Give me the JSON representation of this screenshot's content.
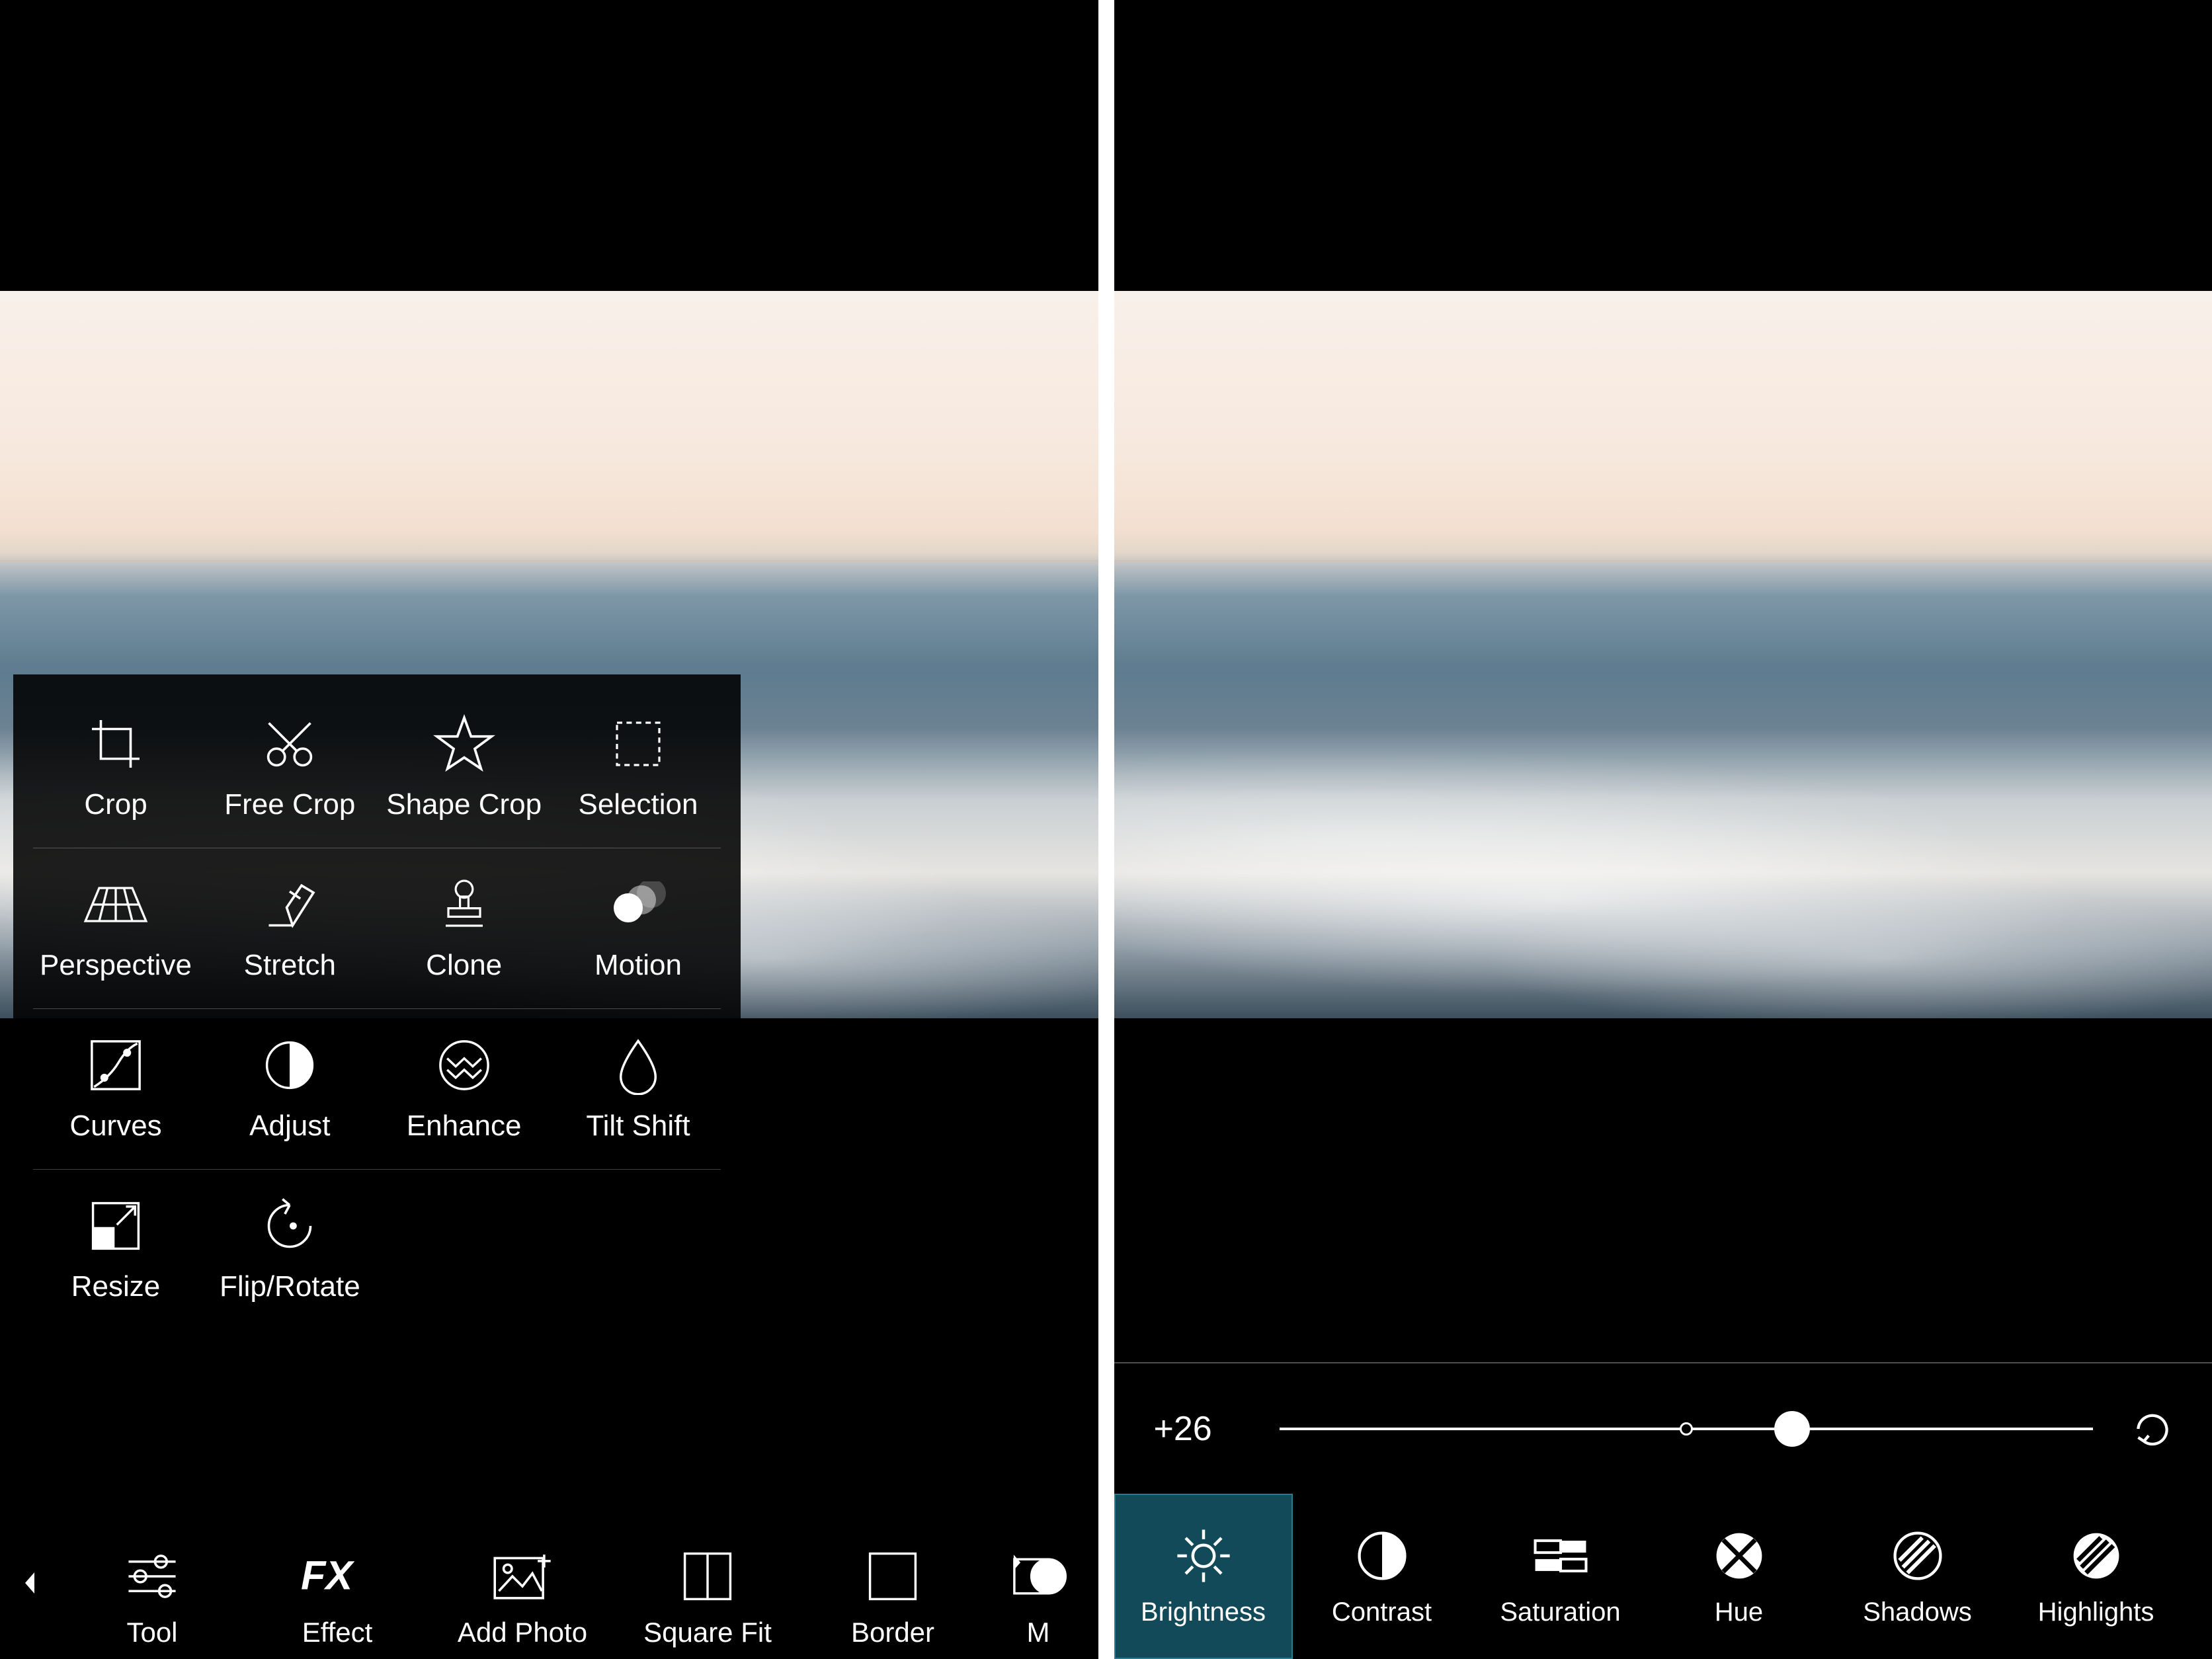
{
  "left": {
    "tool_grid": {
      "rows": [
        [
          {
            "id": "crop",
            "label": "Crop",
            "icon": "crop-icon"
          },
          {
            "id": "free-crop",
            "label": "Free Crop",
            "icon": "scissors-icon"
          },
          {
            "id": "shape-crop",
            "label": "Shape Crop",
            "icon": "star-icon"
          },
          {
            "id": "selection",
            "label": "Selection",
            "icon": "selection-dashed-icon"
          }
        ],
        [
          {
            "id": "perspective",
            "label": "Perspective",
            "icon": "perspective-grid-icon"
          },
          {
            "id": "stretch",
            "label": "Stretch",
            "icon": "stretch-hand-icon"
          },
          {
            "id": "clone",
            "label": "Clone",
            "icon": "stamp-icon"
          },
          {
            "id": "motion",
            "label": "Motion",
            "icon": "motion-blur-icon"
          }
        ],
        [
          {
            "id": "curves",
            "label": "Curves",
            "icon": "curves-icon"
          },
          {
            "id": "adjust",
            "label": "Adjust",
            "icon": "half-circle-icon"
          },
          {
            "id": "enhance",
            "label": "Enhance",
            "icon": "waves-icon"
          },
          {
            "id": "tilt-shift",
            "label": "Tilt Shift",
            "icon": "drop-icon"
          }
        ],
        [
          {
            "id": "resize",
            "label": "Resize",
            "icon": "resize-arrows-icon"
          },
          {
            "id": "flip-rotate",
            "label": "Flip/Rotate",
            "icon": "rotate-icon"
          }
        ]
      ]
    },
    "bottom_nav": {
      "items": [
        {
          "id": "tool",
          "label": "Tool",
          "icon": "sliders-icon"
        },
        {
          "id": "effect",
          "label": "Effect",
          "icon": "fx-icon"
        },
        {
          "id": "add-photo",
          "label": "Add Photo",
          "icon": "add-photo-icon"
        },
        {
          "id": "square-fit",
          "label": "Square Fit",
          "icon": "square-fit-icon"
        },
        {
          "id": "border",
          "label": "Border",
          "icon": "border-icon"
        },
        {
          "id": "mask",
          "label": "M",
          "icon": "mask-shape-icon"
        }
      ]
    }
  },
  "right": {
    "slider": {
      "value_text": "+26",
      "value": 26,
      "min": -100,
      "max": 100,
      "center_pct": 50,
      "knob_pct": 63
    },
    "adjust_tabs": [
      {
        "id": "brightness",
        "label": "Brightness",
        "icon": "brightness-icon",
        "active": true
      },
      {
        "id": "contrast",
        "label": "Contrast",
        "icon": "half-circle-icon",
        "active": false
      },
      {
        "id": "saturation",
        "label": "Saturation",
        "icon": "saturation-bars-icon",
        "active": false
      },
      {
        "id": "hue",
        "label": "Hue",
        "icon": "hue-cross-circle-icon",
        "active": false
      },
      {
        "id": "shadows",
        "label": "Shadows",
        "icon": "shadows-hatch-icon",
        "active": false
      },
      {
        "id": "highlights",
        "label": "Highlights",
        "icon": "highlights-hatch-icon",
        "active": false
      }
    ]
  },
  "colors": {
    "bg": "#000000",
    "fg": "#ffffff",
    "accent_tab": "#134a5a"
  }
}
